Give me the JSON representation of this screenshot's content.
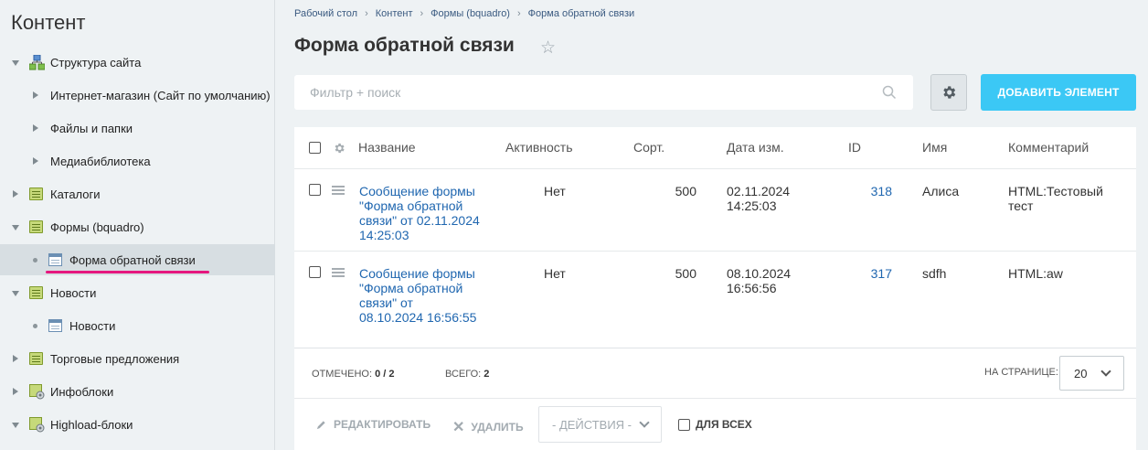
{
  "sidebar": {
    "title": "Контент",
    "items": [
      {
        "label": "Структура сайта"
      },
      {
        "label": "Интернет-магазин (Сайт по умолчанию)"
      },
      {
        "label": "Файлы и папки"
      },
      {
        "label": "Медиабиблиотека"
      },
      {
        "label": "Каталоги"
      },
      {
        "label": "Формы (bquadro)"
      },
      {
        "label": "Форма обратной связи"
      },
      {
        "label": "Новости"
      },
      {
        "label": "Новости"
      },
      {
        "label": "Торговые предложения"
      },
      {
        "label": "Инфоблоки"
      },
      {
        "label": "Highload-блоки"
      }
    ]
  },
  "breadcrumb": [
    "Рабочий стол",
    "Контент",
    "Формы (bquadro)",
    "Форма обратной связи"
  ],
  "page": {
    "title": "Форма обратной связи"
  },
  "toolbar": {
    "search_placeholder": "Фильтр + поиск",
    "add_label": "ДОБАВИТЬ ЭЛЕМЕНТ"
  },
  "table": {
    "columns": [
      "Название",
      "Активность",
      "Сорт.",
      "Дата изм.",
      "ID",
      "Имя",
      "Комментарий"
    ],
    "rows": [
      {
        "name": "Сообщение формы \"Форма обратной связи\" от 02.11.2024 14:25:03",
        "active": "Нет",
        "sort": "500",
        "date": "02.11.2024 14:25:03",
        "id": "318",
        "user": "Алиса",
        "comment": "HTML:Тестовый тест"
      },
      {
        "name": "Сообщение формы \"Форма обратной связи\" от 08.10.2024 16:56:55",
        "active": "Нет",
        "sort": "500",
        "date": "08.10.2024 16:56:56",
        "id": "317",
        "user": "sdfh",
        "comment": "HTML:aw"
      }
    ]
  },
  "footer": {
    "selected_label": "ОТМЕЧЕНО:",
    "selected_value": "0 / 2",
    "total_label": "ВСЕГО:",
    "total_value": "2",
    "per_page_label": "НА СТРАНИЦЕ:",
    "per_page_value": "20"
  },
  "actions": {
    "edit_label": "РЕДАКТИРОВАТЬ",
    "delete_label": "УДАЛИТЬ",
    "actions_placeholder": "- ДЕЙСТВИЯ -",
    "for_all_label": "ДЛЯ ВСЕХ"
  },
  "colors": {
    "accent": "#3bc8f5",
    "link": "#2067b0",
    "active_marker": "#e5177e"
  }
}
